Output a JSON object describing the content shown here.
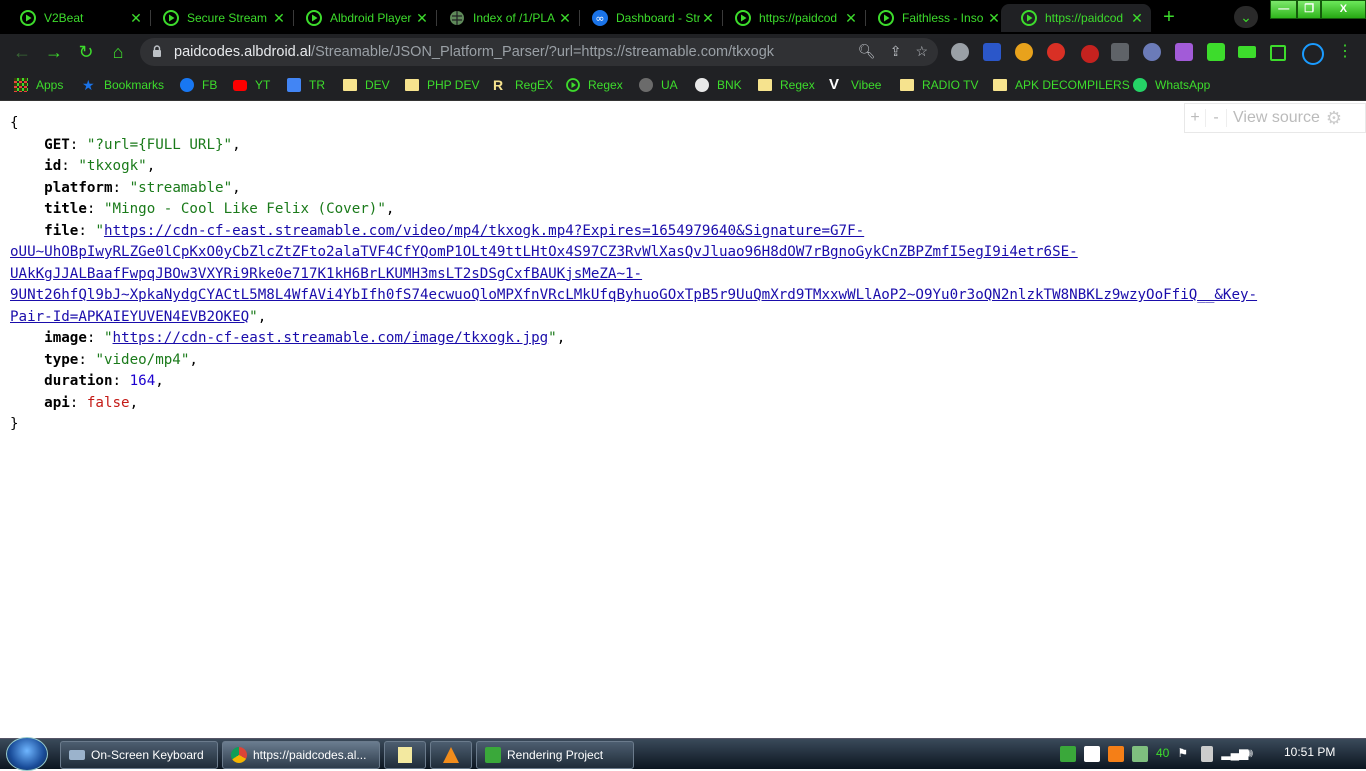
{
  "browser": {
    "tabs": [
      {
        "label": "V2Beat",
        "icon": "play-circle-icon"
      },
      {
        "label": "Secure Stream",
        "icon": "play-circle-icon"
      },
      {
        "label": "Albdroid Player",
        "icon": "play-circle-icon"
      },
      {
        "label": "Index of /1/PLA",
        "icon": "globe-icon"
      },
      {
        "label": "Dashboard - Str",
        "icon": "infinity-icon"
      },
      {
        "label": "https://paidcod",
        "icon": "play-circle-icon"
      },
      {
        "label": "Faithless - Inso",
        "icon": "play-circle-icon"
      },
      {
        "label": "https://paidcod",
        "icon": "play-circle-icon",
        "active": true
      }
    ],
    "new_tab_label": "+",
    "tab_search_label": "⌄",
    "window_controls": {
      "minimize": "—",
      "restore": "❐",
      "close": "X"
    },
    "address": {
      "host": "paidcodes.albdroid.al",
      "path": "/Streamable/JSON_Platform_Parser/?url=https://streamable.com/tkxogk"
    },
    "bookmarks": [
      {
        "label": "Apps",
        "icon": "apps-grid-icon"
      },
      {
        "label": "Bookmarks",
        "icon": "star-icon"
      },
      {
        "label": "FB",
        "icon": "facebook-icon"
      },
      {
        "label": "YT",
        "icon": "youtube-icon"
      },
      {
        "label": "TR",
        "icon": "translate-icon"
      },
      {
        "label": "DEV",
        "icon": "folder-icon"
      },
      {
        "label": "PHP DEV",
        "icon": "folder-icon"
      },
      {
        "label": "RegEX",
        "icon": "regex-r-icon"
      },
      {
        "label": "Regex",
        "icon": "play-circle-icon"
      },
      {
        "label": "UA",
        "icon": "globe-icon"
      },
      {
        "label": "BNK",
        "icon": "bnk-icon"
      },
      {
        "label": "Regex",
        "icon": "folder-icon"
      },
      {
        "label": "Vibee",
        "icon": "vibee-v-icon"
      },
      {
        "label": "RADIO TV",
        "icon": "folder-icon"
      },
      {
        "label": "APK DECOMPILERS",
        "icon": "folder-icon"
      },
      {
        "label": "WhatsApp",
        "icon": "whatsapp-icon"
      }
    ]
  },
  "viewer": {
    "plus": "+",
    "minus": "-",
    "view_source": "View source"
  },
  "json": {
    "open_brace": "{",
    "close_brace": "}",
    "fields": {
      "get_key": "GET",
      "get_value": "\"?url={FULL URL}\"",
      "id_key": "id",
      "id_value": "\"tkxogk\"",
      "platform_key": "platform",
      "platform_value": "\"streamable\"",
      "title_key": "title",
      "title_value": "\"Mingo - Cool Like Felix (Cover)\"",
      "file_key": "file",
      "file_line1": "https://cdn-cf-east.streamable.com/video/mp4/tkxogk.mp4?Expires=1654979640&Signature=G7F-",
      "file_line2": "oUU~UhOBpIwyRLZGe0lCpKxO0yCbZlcZtZFto2alaTVF4CfYQomP1OLt49ttLHtOx4S97CZ3RvWlXasQvJluao96H8dOW7rBgnoGykCnZBPZmfI5egI9i4etr6SE-",
      "file_line3": "UAkKgJJALBaafFwpqJBOw3VXYRi9Rke0e717K1kH6BrLKUMH3msLT2sDSgCxfBAUKjsMeZA~1-",
      "file_line4": "9UNt26hfQl9bJ~XpkaNydgCYACtL5M8L4WfAVi4YbIfh0fS74ecwuoQloMPXfnVRcLMkUfqByhuoGOxTpB5r9UuQmXrd9TMxxwWLlAoP2~O9Yu0r3oQN2nlzkTW8NBKLz9wzyOoFfiQ__&Key-",
      "file_line5": "Pair-Id=APKAIEYUVEN4EVB2OKEQ",
      "image_key": "image",
      "image_url": "https://cdn-cf-east.streamable.com/image/tkxogk.jpg",
      "type_key": "type",
      "type_value": "\"video/mp4\"",
      "duration_key": "duration",
      "duration_value": "164",
      "api_key": "api",
      "api_value": "false"
    }
  },
  "taskbar": {
    "items": [
      {
        "label": "On-Screen Keyboard",
        "icon": "keyboard-icon"
      },
      {
        "label": "https://paidcodes.al...",
        "icon": "chrome-icon"
      },
      {
        "label": "",
        "icon": "notepad-icon"
      },
      {
        "label": "",
        "icon": "vlc-icon"
      },
      {
        "label": "Rendering Project",
        "icon": "camtasia-icon"
      }
    ],
    "tray_battery": "40",
    "clock": "10:51 PM"
  },
  "colors": {
    "accent": "#3ddc2c",
    "chrome_dark": "#202124",
    "link": "#1a0dab",
    "string": "#1a7a1a"
  }
}
